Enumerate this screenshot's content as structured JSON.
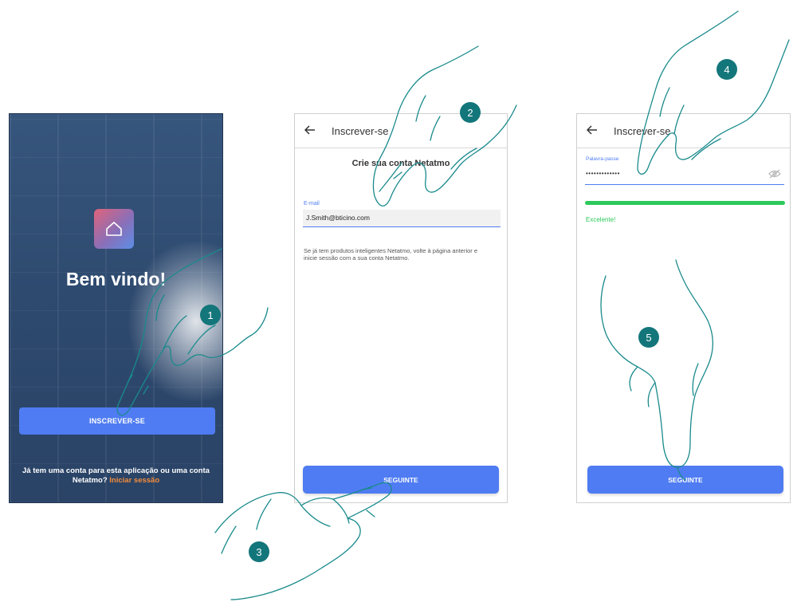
{
  "screen1": {
    "welcome_title": "Bem vindo!",
    "signup_button": "INSCREVER-SE",
    "login_prompt": "Já tem uma conta para esta aplicação ou uma conta Netatmo?",
    "login_link": "Iniciar sessão",
    "app_icon": "home-icon"
  },
  "screen2": {
    "back_icon": "arrow-left-icon",
    "title": "Inscrever-se",
    "heading": "Crie sua conta Netatmo",
    "email_label": "E-mail",
    "email_value": "J.Smith@bticino.com",
    "info_text": "Se já tem produtos inteligentes Netatmo, volte à página anterior e inicie sessão com a sua conta Netatmo.",
    "next_button": "SEGUINTE"
  },
  "screen3": {
    "back_icon": "arrow-left-icon",
    "title": "Inscrever-se",
    "password_label": "Palavra-passe",
    "password_value": "•••••••••••••",
    "visibility_icon": "eye-off-icon",
    "strength_label": "Excelente!",
    "next_button": "SEGUINTE"
  },
  "steps": [
    "1",
    "2",
    "3",
    "4",
    "5"
  ],
  "colors": {
    "primary_button": "#4f7cf2",
    "link_orange": "#f28c3c",
    "strength_green": "#2ec95c",
    "step_badge": "#13767a",
    "welcome_bg": "#2e4a6f"
  }
}
